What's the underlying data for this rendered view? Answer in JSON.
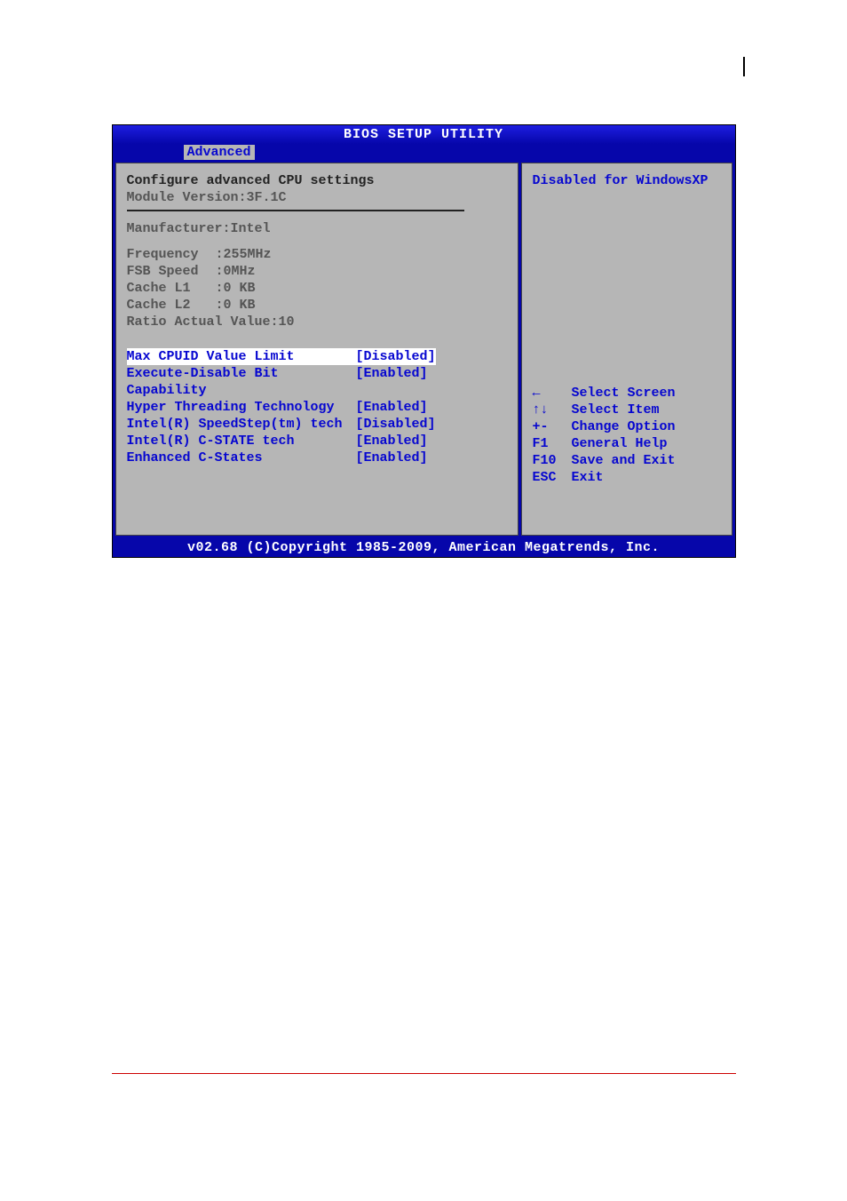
{
  "title": "BIOS SETUP UTILITY",
  "tab": "Advanced",
  "main": {
    "section_title": "Configure advanced CPU settings",
    "module_version": "Module Version:3F.1C",
    "info": {
      "manufacturer_label": "Manufacturer:Intel",
      "freq_label": "Frequency",
      "freq_val": ":255MHz",
      "fsb_label": "FSB Speed",
      "fsb_val": ":0MHz",
      "l1_label": "Cache L1",
      "l1_val": ":0 KB",
      "l2_label": "Cache L2",
      "l2_val": ":0 KB",
      "ratio": "Ratio Actual Value:10"
    },
    "settings": [
      {
        "label": "Max CPUID Value Limit",
        "value": "[Disabled]"
      },
      {
        "label": "Execute-Disable Bit Capability",
        "value": "[Enabled]"
      },
      {
        "label": "Hyper Threading Technology",
        "value": "[Enabled]"
      },
      {
        "label": "Intel(R) SpeedStep(tm) tech",
        "value": "[Disabled]"
      },
      {
        "label": "Intel(R)  C-STATE tech",
        "value": "[Enabled]"
      },
      {
        "label": "Enhanced C-States",
        "value": "[Enabled]"
      }
    ]
  },
  "side": {
    "help": "Disabled for WindowsXP",
    "keys": [
      {
        "key": "←",
        "desc": "Select Screen"
      },
      {
        "key": "↑↓",
        "desc": "Select Item"
      },
      {
        "key": "+-",
        "desc": "Change Option"
      },
      {
        "key": "F1",
        "desc": "General Help"
      },
      {
        "key": "F10",
        "desc": "Save and Exit"
      },
      {
        "key": "ESC",
        "desc": "Exit"
      }
    ]
  },
  "footer": "v02.68 (C)Copyright 1985-2009, American Megatrends, Inc."
}
